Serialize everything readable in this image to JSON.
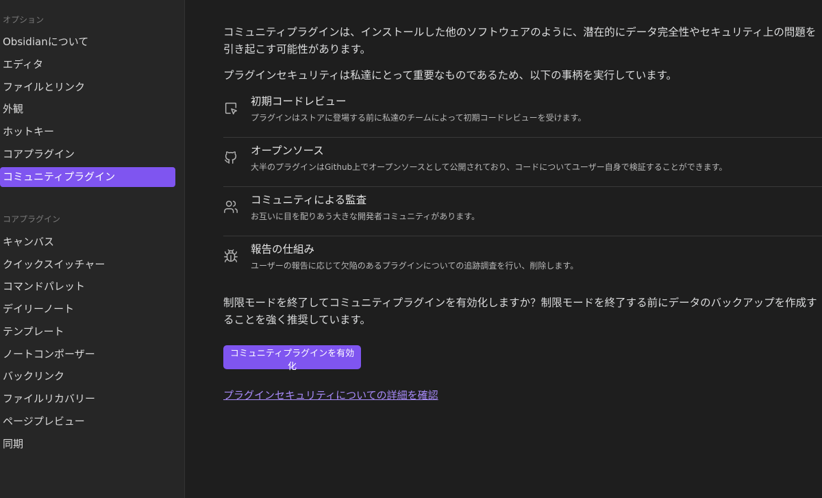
{
  "sidebar": {
    "options_title": "オプション",
    "options_items": [
      {
        "label": "Obsidianについて",
        "active": false
      },
      {
        "label": "エディタ",
        "active": false
      },
      {
        "label": "ファイルとリンク",
        "active": false
      },
      {
        "label": "外観",
        "active": false
      },
      {
        "label": "ホットキー",
        "active": false
      },
      {
        "label": "コアプラグイン",
        "active": false
      },
      {
        "label": "コミュニティプラグイン",
        "active": true
      }
    ],
    "core_title": "コアプラグイン",
    "core_items": [
      {
        "label": "キャンバス"
      },
      {
        "label": "クイックスイッチャー"
      },
      {
        "label": "コマンドパレット"
      },
      {
        "label": "デイリーノート"
      },
      {
        "label": "テンプレート"
      },
      {
        "label": "ノートコンポーザー"
      },
      {
        "label": "バックリンク"
      },
      {
        "label": "ファイルリカバリー"
      },
      {
        "label": "ページプレビュー"
      },
      {
        "label": "同期"
      }
    ]
  },
  "main": {
    "intro": "コミュニティプラグインは、インストールした他のソフトウェアのように、潜在的にデータ完全性やセキュリティ上の問題を引き起こす可能性があります。",
    "security_statement": "プラグインセキュリティは私達にとって重要なものであるため、以下の事柄を実行しています。",
    "features": [
      {
        "icon": "code-review-icon",
        "title": "初期コードレビュー",
        "description": "プラグインはストアに登場する前に私達のチームによって初期コードレビューを受けます。"
      },
      {
        "icon": "github-icon",
        "title": "オープンソース",
        "description": "大半のプラグインはGithub上でオープンソースとして公開されており、コードについてユーザー自身で検証することができます。"
      },
      {
        "icon": "users-icon",
        "title": "コミュニティによる監査",
        "description": "お互いに目を配りあう大きな開発者コミュニティがあります。"
      },
      {
        "icon": "bug-icon",
        "title": "報告の仕組み",
        "description": "ユーザーの報告に応じて欠陥のあるプラグインについての追跡調査を行い、削除します。"
      }
    ],
    "restricted_notice": "制限モードを終了してコミュニティプラグインを有効化しますか？制限モードを終了する前にデータのバックアップを作成することを強く推奨しています。",
    "enable_button": "コミュニティプラグインを有効化",
    "security_link": "プラグインセキュリティについての詳細を確認"
  },
  "colors": {
    "accent": "#7f55f0",
    "link": "#a88bfa",
    "background": "#1e1e1e",
    "sidebar_background": "#262626"
  }
}
